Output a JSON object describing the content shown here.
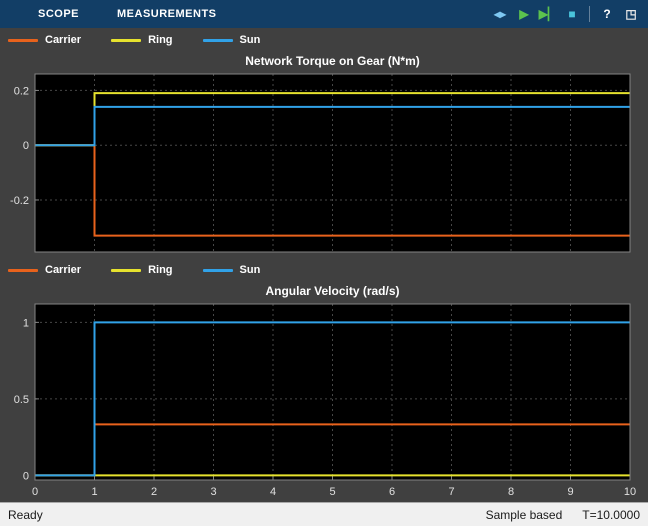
{
  "toolbar": {
    "tabs": [
      {
        "label": "SCOPE"
      },
      {
        "label": "MEASUREMENTS"
      }
    ],
    "icons": [
      {
        "type": "button",
        "name": "simulink",
        "glyph": "◂▸",
        "color": "#7EC8F2"
      },
      {
        "type": "button",
        "name": "run",
        "glyph": "▶",
        "color": "#5CC24E"
      },
      {
        "type": "button",
        "name": "step-forward",
        "glyph": "▶▏",
        "color": "#5CC24E"
      },
      {
        "type": "button",
        "name": "stop",
        "glyph": "■",
        "color": "#49C4DB"
      },
      {
        "type": "separator"
      },
      {
        "type": "button",
        "name": "help",
        "glyph": "?",
        "color": "#FFFFFF"
      },
      {
        "type": "button",
        "name": "dock",
        "glyph": "◳",
        "color": "#E8E8E8"
      }
    ]
  },
  "chart_style": {
    "plot_bg": "#000000",
    "grid_color": "#474747",
    "axis_color": "#848484",
    "tick_color": "#E0E0E0",
    "figure_bg": "#404040"
  },
  "chart_data": [
    {
      "type": "line",
      "title": "Network Torque on Gear (N*m)",
      "xlim": [
        0,
        10
      ],
      "ylim": [
        -0.39,
        0.26
      ],
      "xticks": [
        0,
        1,
        2,
        3,
        4,
        5,
        6,
        7,
        8,
        9,
        10
      ],
      "yticks": [
        0.2,
        0,
        -0.2
      ],
      "show_x_labels": false,
      "grid": true,
      "legend_position": "top-left",
      "series": [
        {
          "name": "Carrier",
          "color": "#E8621C",
          "points": [
            [
              0,
              0
            ],
            [
              1,
              0
            ],
            [
              1,
              -0.33
            ],
            [
              10,
              -0.33
            ]
          ]
        },
        {
          "name": "Ring",
          "color": "#E6E22E",
          "points": [
            [
              0,
              0
            ],
            [
              1,
              0
            ],
            [
              1,
              0.19
            ],
            [
              10,
              0.19
            ]
          ]
        },
        {
          "name": "Sun",
          "color": "#31A2E8",
          "points": [
            [
              0,
              0
            ],
            [
              1,
              0
            ],
            [
              1,
              0.14
            ],
            [
              10,
              0.14
            ]
          ]
        }
      ]
    },
    {
      "type": "line",
      "title": "Angular Velocity (rad/s)",
      "xlim": [
        0,
        10
      ],
      "ylim": [
        -0.03,
        1.12
      ],
      "xticks": [
        0,
        1,
        2,
        3,
        4,
        5,
        6,
        7,
        8,
        9,
        10
      ],
      "yticks": [
        1,
        0.5,
        0
      ],
      "show_x_labels": true,
      "grid": true,
      "legend_position": "top-left",
      "series": [
        {
          "name": "Carrier",
          "color": "#E8621C",
          "points": [
            [
              0,
              0
            ],
            [
              1,
              0
            ],
            [
              1,
              0.3333
            ],
            [
              10,
              0.3333
            ]
          ]
        },
        {
          "name": "Ring",
          "color": "#E6E22E",
          "points": [
            [
              0,
              0
            ],
            [
              1,
              0
            ],
            [
              1,
              0
            ],
            [
              10,
              0
            ]
          ]
        },
        {
          "name": "Sun",
          "color": "#31A2E8",
          "points": [
            [
              0,
              0
            ],
            [
              1,
              0
            ],
            [
              1,
              1
            ],
            [
              10,
              1
            ]
          ]
        }
      ]
    }
  ],
  "status_bar": {
    "left": "Ready",
    "sample_mode": "Sample based",
    "time": "T=10.0000"
  }
}
